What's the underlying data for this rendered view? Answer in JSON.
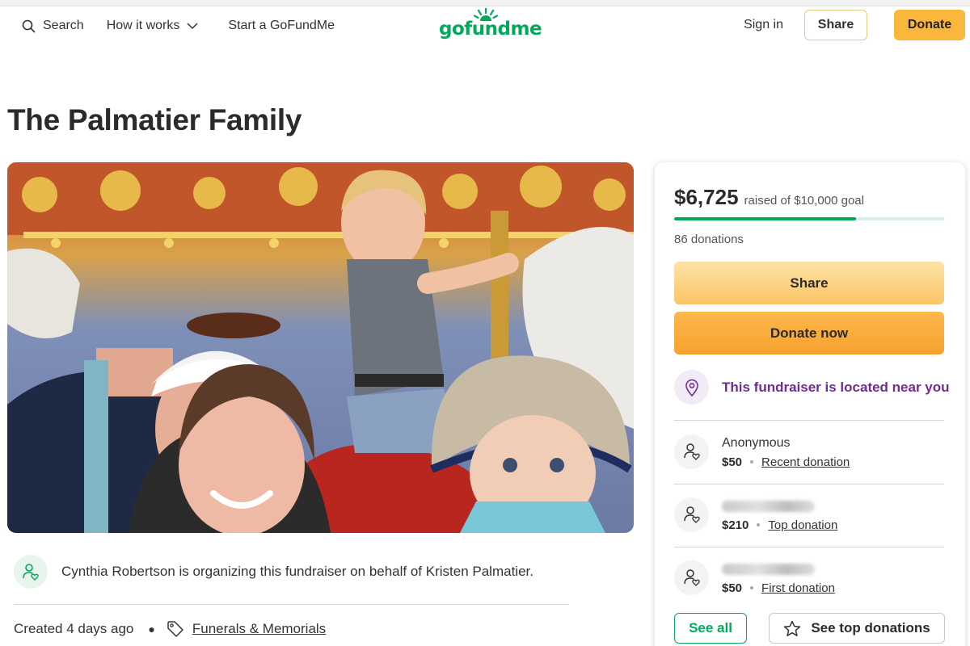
{
  "header": {
    "search_label": "Search",
    "how_it_works_label": "How it works",
    "start_label": "Start a GoFundMe",
    "logo_text": "gofundme",
    "signin_label": "Sign in",
    "share_label": "Share",
    "donate_label": "Donate"
  },
  "campaign": {
    "title": "The Palmatier Family",
    "organizer_text": "Cynthia Robertson is organizing this fundraiser on behalf of Kristen Palmatier.",
    "created_text": "Created 4 days ago",
    "category": "Funerals & Memorials"
  },
  "sidebar": {
    "raised_amount": "$6,725",
    "raised_goal_text": "raised of $10,000 goal",
    "progress_percent": 67.25,
    "donation_count_text": "86 donations",
    "share_button": "Share",
    "donate_button": "Donate now",
    "location_text": "This fundraiser is located near you",
    "donations": [
      {
        "name": "Anonymous",
        "amount": "$50",
        "type": "Recent donation",
        "name_hidden": false
      },
      {
        "name": "",
        "amount": "$210",
        "type": "Top donation",
        "name_hidden": true
      },
      {
        "name": "",
        "amount": "$50",
        "type": "First donation",
        "name_hidden": true
      }
    ],
    "see_all_button": "See all",
    "see_top_button": "See top donations"
  },
  "colors": {
    "brand_green": "#02a95c",
    "donate_orange": "#fbb73b",
    "location_purple": "#6f2c91"
  },
  "icons": {
    "search": "search-icon",
    "chevron": "chevron-down-icon",
    "organizer": "user-heart-icon",
    "tag": "tag-icon",
    "location": "location-pin-icon",
    "donor": "user-heart-icon",
    "star": "star-icon"
  }
}
